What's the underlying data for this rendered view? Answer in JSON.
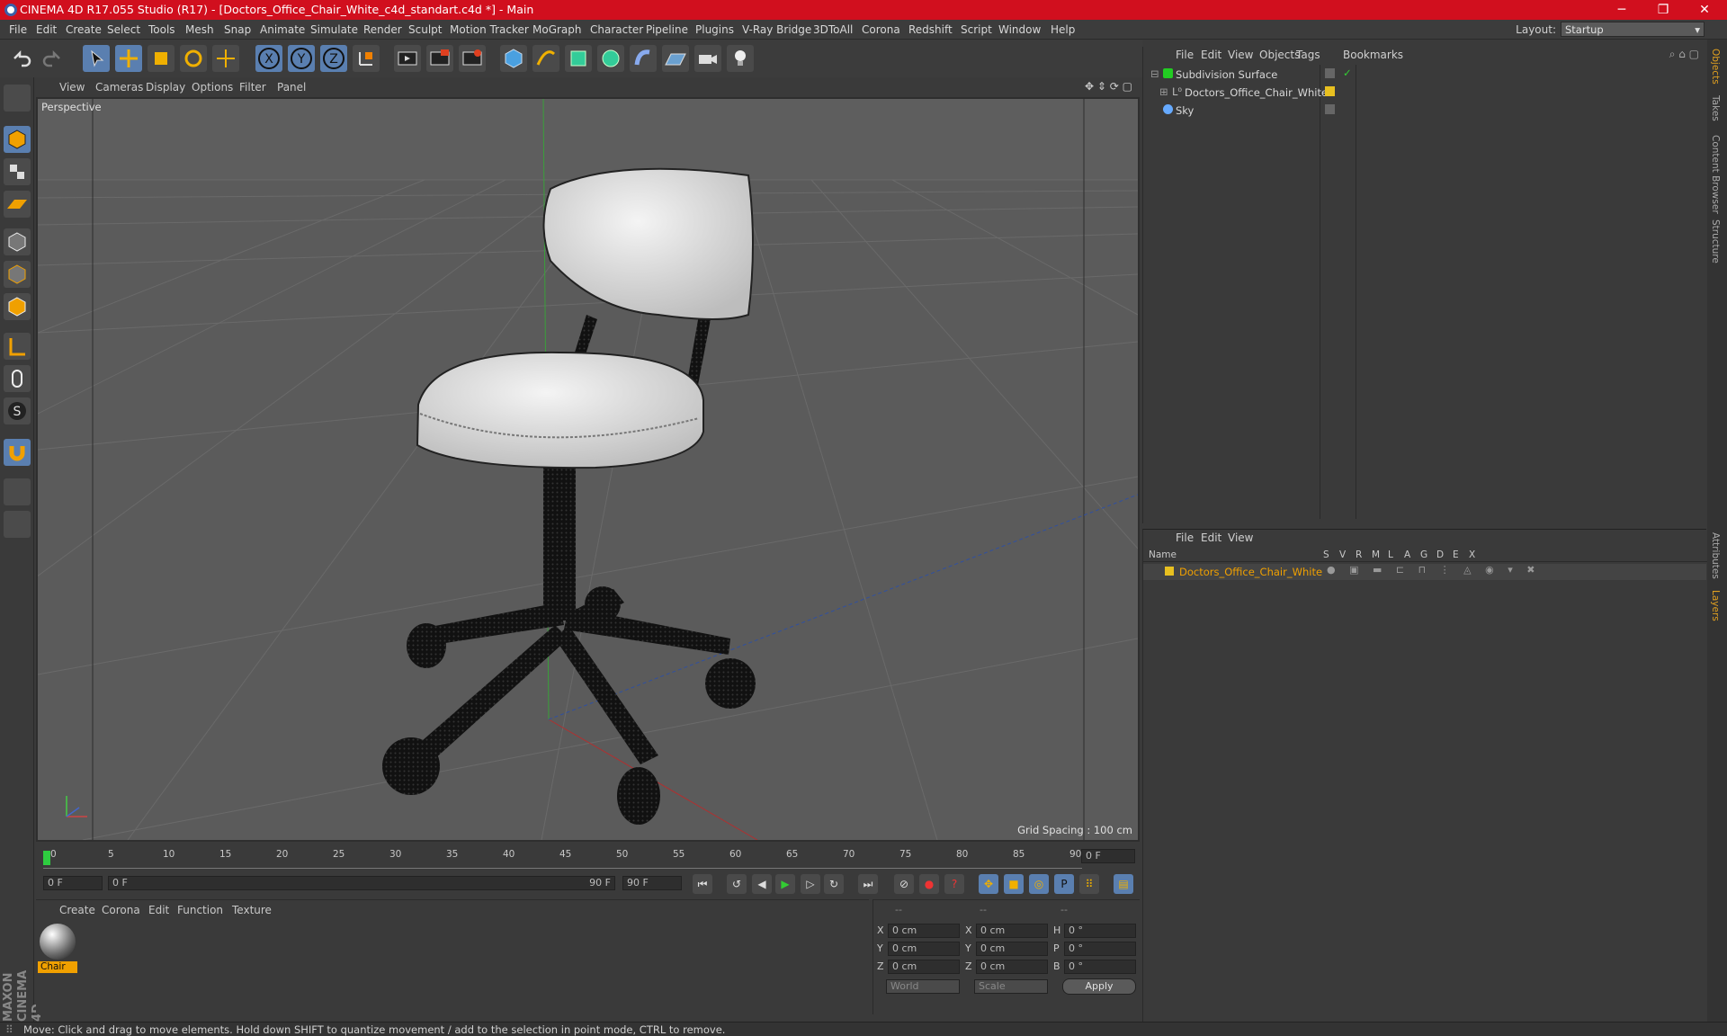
{
  "window": {
    "title": "CINEMA 4D R17.055 Studio (R17) - [Doctors_Office_Chair_White_c4d_standart.c4d *] - Main",
    "minimize": "─",
    "restore": "❐",
    "close": "✕"
  },
  "menu": [
    "File",
    "Edit",
    "Create",
    "Select",
    "Tools",
    "Mesh",
    "Snap",
    "Animate",
    "Simulate",
    "Render",
    "Sculpt",
    "Motion Tracker",
    "MoGraph",
    "Character",
    "Pipeline",
    "Plugins",
    "V-Ray Bridge",
    "3DToAll",
    "Corona",
    "Redshift",
    "Script",
    "Window",
    "Help"
  ],
  "layout": {
    "label": "Layout:",
    "value": "Startup"
  },
  "viewport": {
    "menu": [
      "View",
      "Cameras",
      "Display",
      "Options",
      "Filter",
      "Panel"
    ],
    "label": "Perspective",
    "grid_spacing": "Grid Spacing : 100 cm"
  },
  "timeline": {
    "ticks": [
      "0",
      "5",
      "10",
      "15",
      "20",
      "25",
      "30",
      "35",
      "40",
      "45",
      "50",
      "55",
      "60",
      "65",
      "70",
      "75",
      "80",
      "85",
      "90"
    ],
    "current": "0 F"
  },
  "transport": {
    "start": "0 F",
    "range_start": "0 F",
    "range_end": "90 F",
    "end": "90 F"
  },
  "material_manager": {
    "menu": [
      "Create",
      "Corona",
      "Edit",
      "Function",
      "Texture"
    ],
    "material_name": "Chair"
  },
  "coordinates": {
    "header_a": "--",
    "header_b": "--",
    "header_c": "--",
    "rows": [
      {
        "l1": "X",
        "v1": "0 cm",
        "l2": "X",
        "v2": "0 cm",
        "l3": "H",
        "v3": "0 °"
      },
      {
        "l1": "Y",
        "v1": "0 cm",
        "l2": "Y",
        "v2": "0 cm",
        "l3": "P",
        "v3": "0 °"
      },
      {
        "l1": "Z",
        "v1": "0 cm",
        "l2": "Z",
        "v2": "0 cm",
        "l3": "B",
        "v3": "0 °"
      }
    ],
    "mode": "World",
    "scale": "Scale",
    "apply": "Apply"
  },
  "object_manager": {
    "menu": [
      "File",
      "Edit",
      "View",
      "Objects",
      "Tags",
      "Bookmarks"
    ],
    "objects": [
      {
        "name": "Subdivision Surface"
      },
      {
        "name": "Doctors_Office_Chair_White"
      },
      {
        "name": "Sky"
      }
    ]
  },
  "layer_manager": {
    "menu": [
      "File",
      "Edit",
      "View"
    ],
    "col_name": "Name",
    "cols": [
      "S",
      "V",
      "R",
      "M",
      "L",
      "A",
      "G",
      "D",
      "E",
      "X"
    ],
    "layer": "Doctors_Office_Chair_White",
    "layer_color": "#e8c020"
  },
  "right_tabs": [
    "Objects",
    "Takes",
    "Content Browser",
    "Structure",
    "Attributes",
    "Layers"
  ],
  "status": "Move: Click and drag to move elements. Hold down SHIFT to quantize movement / add to the selection in point mode, CTRL to remove.",
  "brand": "MAXON CINEMA 4D",
  "colors": {
    "title_bar": "#d10f1e",
    "accent_blue": "#5a7fb0",
    "highlight_orange": "#f0a000"
  }
}
